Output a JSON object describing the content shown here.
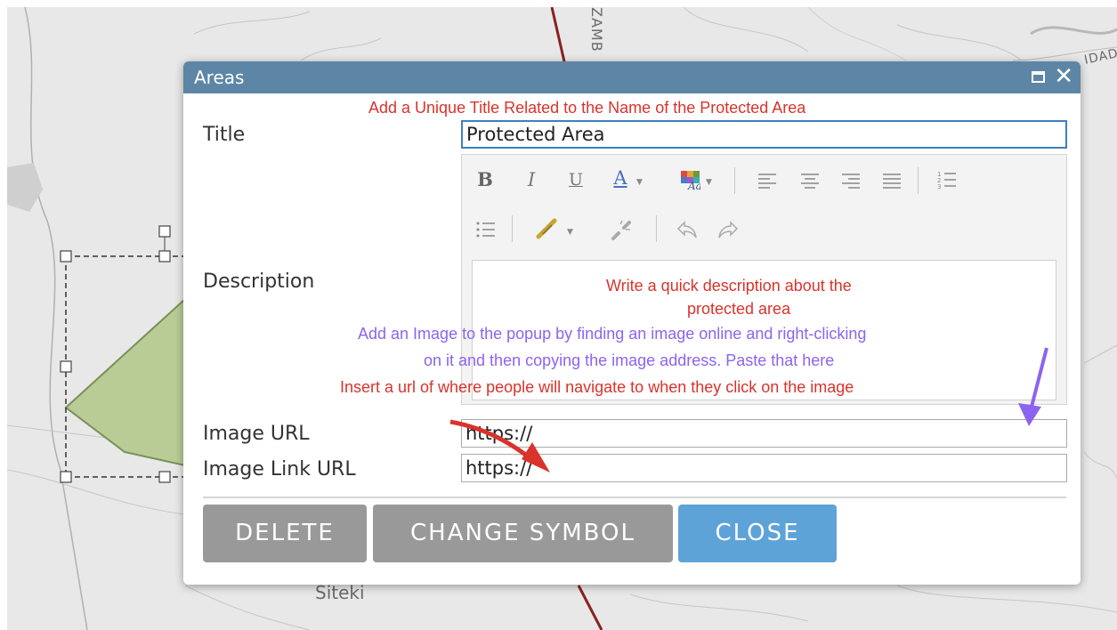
{
  "map": {
    "label_top": "ZAMB",
    "label_top2": "Z",
    "label_right": "IDAD",
    "label_bottom": "Siteki"
  },
  "dialog": {
    "title": "Areas",
    "close_glyph": "✕",
    "fields": {
      "title_label": "Title",
      "title_value": "Protected Area",
      "description_label": "Description",
      "image_url_label": "Image URL",
      "image_url_value": "https://",
      "image_link_label": "Image Link URL",
      "image_link_value": "https://"
    },
    "buttons": {
      "delete": "DELETE",
      "change_symbol": "CHANGE SYMBOL",
      "close": "CLOSE"
    }
  },
  "annotations": {
    "title_hint": "Add a Unique Title Related to the Name of the Protected Area",
    "description_hint_line1": "Write a quick description about the",
    "description_hint_line2": "protected area",
    "image_hint_line1": "Add an Image to the popup by finding an image online and right-clicking",
    "image_hint_line2": "on it and then copying the image address. Paste that here",
    "link_hint": "Insert a url of where people will navigate to when they click on the image"
  },
  "toolbar": {
    "bold": "B",
    "italic": "I",
    "underline": "U",
    "font_color": "A",
    "icons": [
      "bold-icon",
      "italic-icon",
      "underline-icon",
      "font-color-icon",
      "background-color-icon",
      "align-left-icon",
      "align-center-icon",
      "align-right-icon",
      "justify-icon",
      "ordered-list-icon",
      "unordered-list-icon",
      "link-icon",
      "unlink-icon",
      "undo-icon",
      "redo-icon"
    ]
  },
  "colors": {
    "header": "#5d86a6",
    "annotation_red": "#d9332b",
    "annotation_purple": "#8c64ef",
    "button_gray": "#999999",
    "button_blue": "#5ea3d8",
    "polygon_fill": "#b9cc96",
    "road": "#8b2020"
  }
}
